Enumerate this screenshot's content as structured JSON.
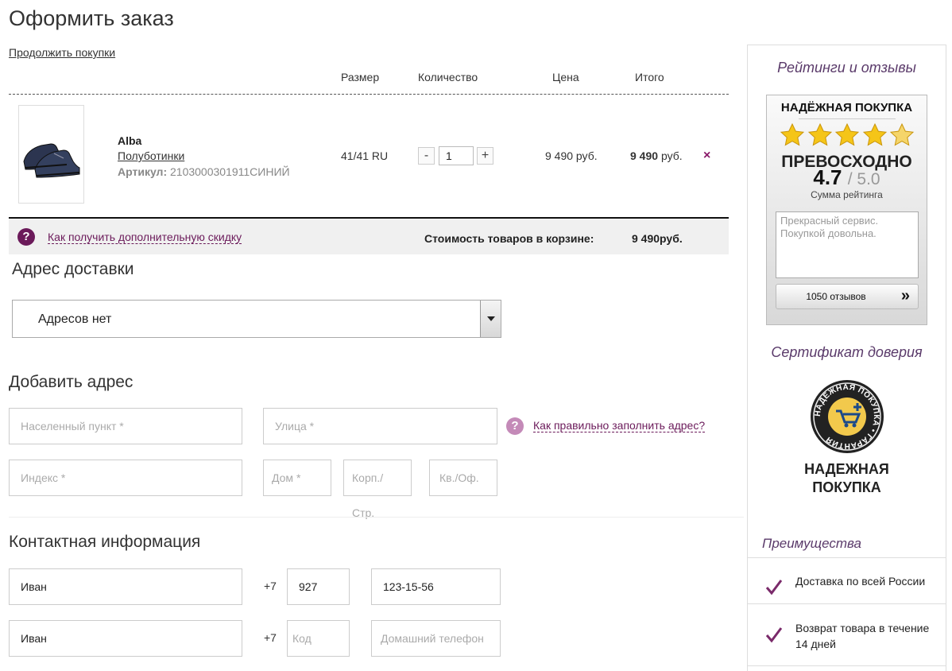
{
  "page": {
    "title": "Оформить заказ",
    "continue_link": "Продолжить покупки"
  },
  "cart": {
    "columns": {
      "size": "Размер",
      "quantity": "Количество",
      "price": "Цена",
      "total": "Итого"
    },
    "items": [
      {
        "name": "Alba",
        "type": "Полуботинки",
        "sku_label": "Артикул:",
        "sku": "2103000301911СИНИЙ",
        "size": "41/41 RU",
        "minus": "-",
        "qty": "1",
        "plus": "+",
        "price": "9 490 руб.",
        "total_number": "9 490",
        "total_currency": "руб.",
        "remove": "×"
      }
    ],
    "help_icon": "?",
    "discount_link": "Как получить дополнительную скидку",
    "sum_label": "Стоимость товаров в корзине:",
    "sum_value": "9 490руб."
  },
  "delivery": {
    "title": "Адрес доставки",
    "select_value": "Адресов нет"
  },
  "add_address": {
    "title": "Добавить адрес",
    "city_placeholder": "Населенный пункт *",
    "street_placeholder": "Улица *",
    "help_icon": "?",
    "help_link": "Как правильно заполнить адрес?",
    "index_placeholder": "Индекс *",
    "house_placeholder": "Дом *",
    "building_placeholder": "Корп./Стр.",
    "apartment_placeholder": "Кв./Оф."
  },
  "contact": {
    "title": "Контактная информация",
    "row1": {
      "name": "Иван",
      "prefix": "+7",
      "code": "927",
      "phone": "123-15-56"
    },
    "row2": {
      "name": "Иван",
      "prefix": "+7",
      "code_placeholder": "Код",
      "phone_placeholder": "Домашний телефон"
    }
  },
  "sidebar": {
    "ratings_title": "Рейтинги и отзывы",
    "rating_widget": {
      "title": "НАДЁЖНАЯ ПОКУПКА",
      "stars": 5,
      "word": "ПРЕВОСХОДНО",
      "score": "4.7",
      "score_max": "/ 5.0",
      "score_label": "Сумма рейтинга",
      "review_text": "Прекрасный сервис. Покупкой довольна.",
      "reviews_button": "1050 отзывов",
      "reviews_arrow": "»"
    },
    "certificate_title": "Сертификат доверия",
    "certificate_seal_text": "НАДЕЖНАЯ ПОКУПКА • ГАРАНТИЯ",
    "certificate_line1": "НАДЕЖНАЯ",
    "certificate_line2": "ПОКУПКА",
    "advantages_title": "Преимущества",
    "advantages": [
      {
        "text": "Доставка по всей России"
      },
      {
        "text": "Возврат товара в течение 14 дней"
      }
    ]
  },
  "colors": {
    "accent": "#6b1a5a",
    "sidebar_title": "#5a3a6a",
    "star": "#f5c518"
  }
}
